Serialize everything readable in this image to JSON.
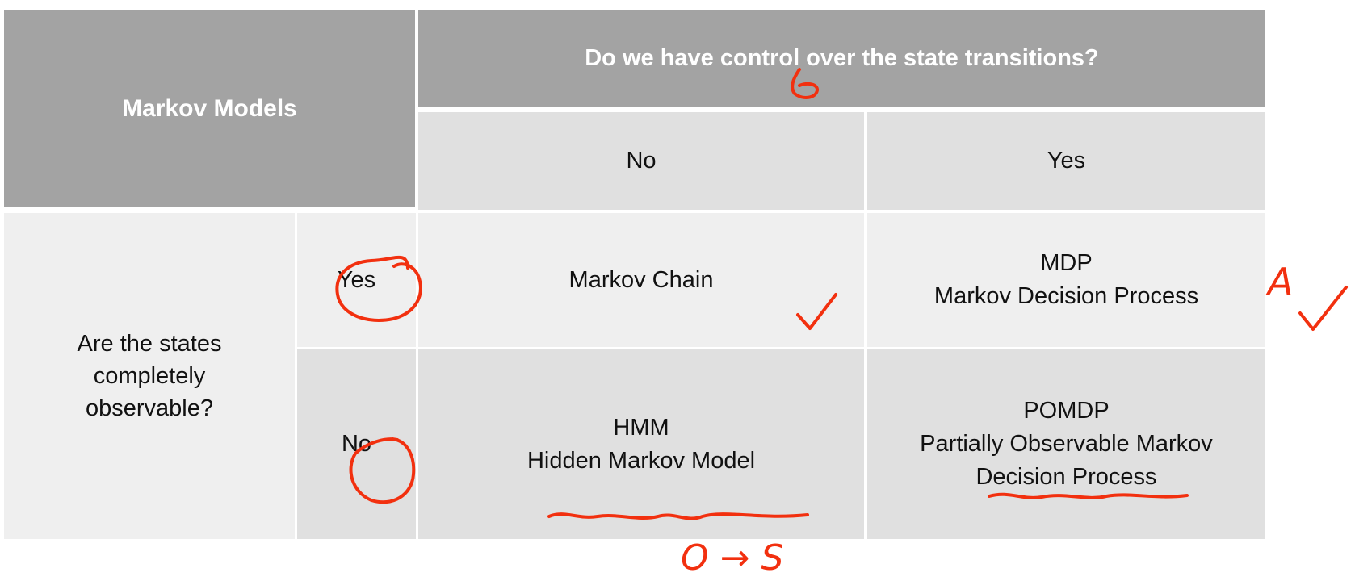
{
  "header": {
    "title": "Markov Models",
    "control_question": "Do we have control over the state transitions?",
    "col_no": "No",
    "col_yes": "Yes"
  },
  "rows": {
    "observability_question": "Are the states completely observable?",
    "row_yes": "Yes",
    "row_no": "No"
  },
  "cells": {
    "markov_chain": "Markov Chain",
    "mdp_abbr": "MDP",
    "mdp_full": "Markov Decision Process",
    "hmm_abbr": "HMM",
    "hmm_full": "Hidden Markov Model",
    "pomdp_abbr": "POMDP",
    "pomdp_full_line1": "Partially Observable Markov",
    "pomdp_full_line2": "Decision Process"
  },
  "annotations": {
    "ink_color": "#f2300f",
    "mdp_note": "A",
    "hmm_note": "O → S",
    "marks": [
      "circle",
      "circle",
      "checkmark",
      "checkmark",
      "underline",
      "underline",
      "small-loop"
    ]
  },
  "colors": {
    "header_dark": "#a3a3a3",
    "cell_mid": "#e0e0e0",
    "cell_light": "#efefef",
    "ink": "#f2300f"
  }
}
